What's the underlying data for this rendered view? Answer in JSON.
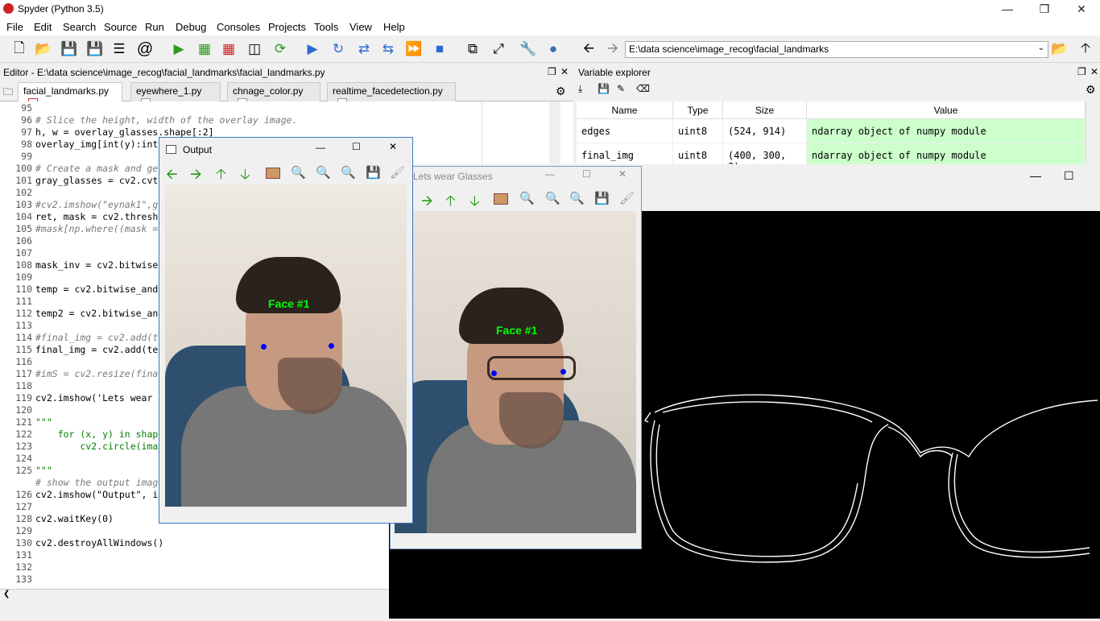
{
  "app": {
    "title": "Spyder (Python 3.5)",
    "logo_icon": "spider-icon"
  },
  "menu": [
    "File",
    "Edit",
    "Search",
    "Source",
    "Run",
    "Debug",
    "Consoles",
    "Projects",
    "Tools",
    "View",
    "Help"
  ],
  "path": {
    "value": "E:\\data science\\image_recog\\facial_landmarks"
  },
  "editor": {
    "title": "Editor - E:\\data science\\image_recog\\facial_landmarks\\facial_landmarks.py",
    "tabs": [
      "facial_landmarks.py",
      "eyewhere_1.py",
      "chnage_color.py",
      "realtime_facedetection.py"
    ],
    "lines": [
      {
        "n": "95",
        "t": ""
      },
      {
        "n": "96",
        "t": "# Slice the height, width of the overlay image."
      },
      {
        "n": "97",
        "t": "h, w = overlay_glasses.shape[:2]"
      },
      {
        "n": "98",
        "t": "overlay_img[int(y):int"
      },
      {
        "n": "99",
        "t": ""
      },
      {
        "n": "100",
        "t": "# Create a mask and ge"
      },
      {
        "n": "101",
        "t": "gray_glasses = cv2.cvt"
      },
      {
        "n": "102",
        "t": ""
      },
      {
        "n": "103",
        "t": "#cv2.imshow(\"eynak1\",g"
      },
      {
        "n": "104",
        "t": "ret, mask = cv2.thresh"
      },
      {
        "n": "105",
        "t": "#mask[np.where((mask ="
      },
      {
        "n": "106",
        "t": ""
      },
      {
        "n": "107",
        "t": ""
      },
      {
        "n": "108",
        "t": "mask_inv = cv2.bitwise"
      },
      {
        "n": "109",
        "t": ""
      },
      {
        "n": "110",
        "t": "temp = cv2.bitwise_and"
      },
      {
        "n": "111",
        "t": ""
      },
      {
        "n": "112",
        "t": "temp2 = cv2.bitwise_an"
      },
      {
        "n": "113",
        "t": ""
      },
      {
        "n": "114",
        "t": "#final_img = cv2.add(t"
      },
      {
        "n": "115",
        "t": "final_img = cv2.add(te"
      },
      {
        "n": "116",
        "t": ""
      },
      {
        "n": "117",
        "t": "#imS = cv2.resize(fina"
      },
      {
        "n": "118",
        "t": ""
      },
      {
        "n": "119",
        "t": "cv2.imshow('Lets wear "
      },
      {
        "n": "120",
        "t": ""
      },
      {
        "n": "121",
        "t": "\"\"\""
      },
      {
        "n": "122",
        "t": "    for (x, y) in shape"
      },
      {
        "n": "123",
        "t": "        cv2.circle(imag"
      },
      {
        "n": "124",
        "t": ""
      },
      {
        "n": "125",
        "t": "\"\"\""
      },
      {
        "n": "",
        "t": "# show the output imag"
      },
      {
        "n": "126",
        "t": "cv2.imshow(\"Output\", i"
      },
      {
        "n": "127",
        "t": ""
      },
      {
        "n": "128",
        "t": "cv2.waitKey(0)"
      },
      {
        "n": "129",
        "t": ""
      },
      {
        "n": "130",
        "t": "cv2.destroyAllWindows()"
      },
      {
        "n": "131",
        "t": ""
      },
      {
        "n": "132",
        "t": ""
      },
      {
        "n": "133",
        "t": ""
      }
    ]
  },
  "variable_explorer": {
    "title": "Variable explorer",
    "headers": [
      "Name",
      "Type",
      "Size",
      "Value"
    ],
    "rows": [
      {
        "name": "edges",
        "type": "uint8",
        "size": "(524, 914)",
        "value": "ndarray object of numpy module"
      },
      {
        "name": "final_img",
        "type": "uint8",
        "size": "(400, 300, 3)",
        "value": "ndarray object of numpy module"
      }
    ]
  },
  "windows": {
    "output": {
      "title": "Output",
      "label": "Face #1"
    },
    "glasses": {
      "title": "Lets wear Glasses",
      "label": "Face #1"
    }
  },
  "colors": {
    "accent_green": "#2b9a1c",
    "landmark_red": "#ff0000",
    "landmark_blue": "#0000ff",
    "label_green": "#00ff00"
  }
}
